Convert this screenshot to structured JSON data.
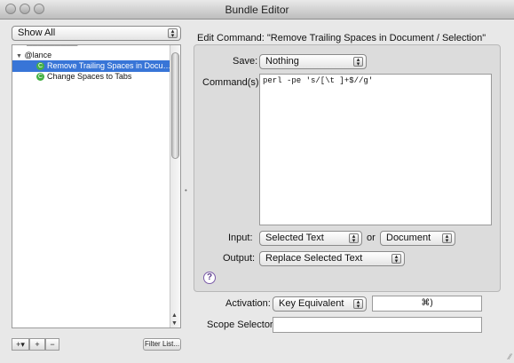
{
  "window": {
    "title": "Bundle Editor"
  },
  "sidebar": {
    "filter_value": "Show All",
    "rows": [
      {
        "label": "@lance",
        "type": "group"
      },
      {
        "label": "Remove Trailing Spaces in Docu…",
        "type": "command",
        "selected": true
      },
      {
        "label": "Change Spaces to Tabs",
        "type": "command",
        "selected": false
      }
    ],
    "add_label": "+▾",
    "add_item_label": "+",
    "remove_label": "−",
    "filter_list_label": "Filter List..."
  },
  "editor": {
    "heading": "Edit Command: \"Remove Trailing Spaces in Document / Selection\"",
    "save_label": "Save:",
    "save_value": "Nothing",
    "commands_label": "Command(s):",
    "command_text": "perl -pe 's/[\\t ]+$//g'",
    "input_label": "Input:",
    "input_value": "Selected Text",
    "or_label": "or",
    "fallback_value": "Document",
    "output_label": "Output:",
    "output_value": "Replace Selected Text",
    "help_label": "?"
  },
  "footer": {
    "activation_label": "Activation:",
    "activation_value": "Key Equivalent",
    "key_equivalent": "⌘)",
    "scope_label": "Scope Selector:",
    "scope_value": ""
  },
  "colors": {
    "selection": "#3875d7",
    "accent_green": "#44b044"
  }
}
